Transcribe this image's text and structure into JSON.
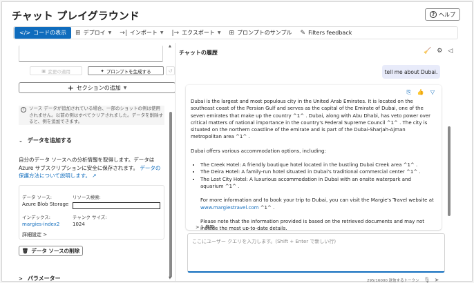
{
  "title": "チャット プレイグラウンド",
  "help_label": "ヘルプ",
  "toolbar": {
    "view_code": "コードの表示",
    "deploy": "デプロイ",
    "import": "インポート",
    "export": "エクスポート",
    "prompt_samples": "プロンプトのサンプル",
    "filters_feedback": "Filters feedback"
  },
  "left": {
    "apply_changes": "変更の適用",
    "generate_prompt": "プロンプトを生成する",
    "add_section": "セクションの追加",
    "notice": "ソース データが追加されている場合、一部のショットの例は使用されません。以前の例はすべてクリアされました。データを削除すると、例を追加できます。",
    "add_data_heading": "データを追加する",
    "description": "自分のデータ ソースへの分析情報を取得します。データは Azure サブスクリプションに安全に保存されます。",
    "description_link": "データの保護方法について説明します。",
    "data_source_label": "データ ソース:",
    "data_source_value": "Azure Blob Storage",
    "resource_search_label": "リソース検索:",
    "index_label": "インデックス:",
    "index_value": "margies-index2",
    "chunk_size_label": "チャンク サイズ:",
    "chunk_size_value": "1024",
    "advanced_settings": "詳細設定",
    "delete_source": "データ ソースの削除",
    "parameters_heading": "パラメーター"
  },
  "chat": {
    "history_title": "チャットの履歴",
    "user_message": "tell me about Dubai.",
    "assistant": {
      "p1": "Dubai is the largest and most populous city in the United Arab Emirates. It is located on the southeast coast of the Persian Gulf and serves as the capital of the Emirate of Dubai, one of the seven emirates that make up the country ^1^ . Dubai, along with Abu Dhabi, has veto power over critical matters of national importance in the country's Federal Supreme Council ^1^ . The city is situated on the northern coastline of the emirate and is part of the Dubai-Sharjah-Ajman metropolitan area ^1^ .",
      "p2": "Dubai offers various accommodation options, including:",
      "items": [
        "The Creek Hotel: A friendly boutique hotel located in the bustling Dubai Creek area ^1^ .",
        "The Deira Hotel: A family-run hotel situated in Dubai's traditional commercial center ^1^ .",
        "The Lost City Hotel: A luxurious accommodation in Dubai with an onsite waterpark and aquarium ^1^ ."
      ],
      "p3_prefix": "For more information and to book your trip to Dubai, you can visit the Margie's Travel website at",
      "p3_link": "www.margiestravel.com",
      "p3_suffix": "^1^ .",
      "p4": "Please note that the information provided is based on the retrieved documents and may not include the most up-to-date details.",
      "refs": "1 参照"
    },
    "input_placeholder": "ここにユーザー クエリを入力します。(Shift + Enter で新しい行)",
    "token_counter": "295/16000 送信するトークン"
  }
}
